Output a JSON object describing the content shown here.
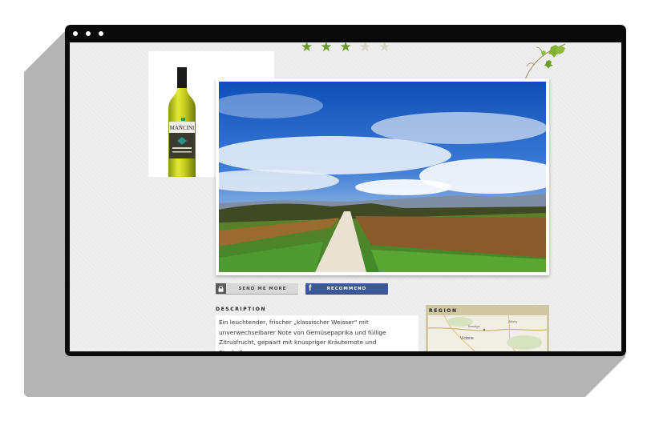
{
  "window": {
    "controls": [
      "close",
      "minimize",
      "maximize"
    ]
  },
  "rating": {
    "value": 3,
    "max": 5
  },
  "product": {
    "bottle_label": "MANCINI"
  },
  "buttons": {
    "send_more": "SEND ME MORE",
    "recommend": "RECOMMEND",
    "facebook_glyph": "f"
  },
  "description": {
    "heading": "DESCRIPTION",
    "text": "Ein leuchtender, frischer „klassischer Weisser\" mit unverwechselbarer Note von Gemüsepaprika und füllige Zitrusfrucht, gepaart mit knuspriger Kräuternote und Stachelbeere."
  },
  "region": {
    "heading": "REGION",
    "map_labels": [
      "Victoria",
      "Bendigo",
      "Albury"
    ]
  },
  "colors": {
    "star_on": "#6a9a2e",
    "star_off": "#d8d6c4",
    "facebook": "#3b5998",
    "browser_frame": "#0a0a0a"
  },
  "icons": [
    "lock-icon",
    "facebook-icon",
    "star-icon",
    "vine-icon"
  ]
}
